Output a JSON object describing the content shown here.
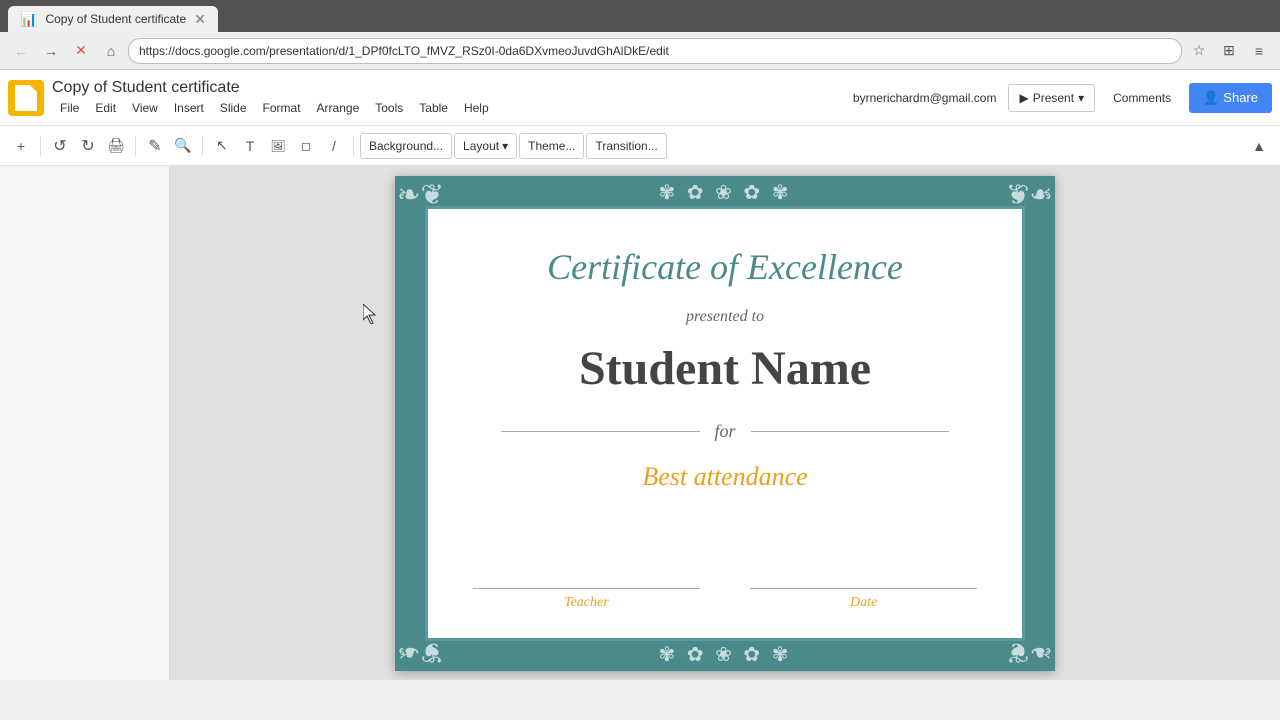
{
  "browser": {
    "url": "https://docs.google.com/presentation/d/1_DPf0fcLTO_fMVZ_RSz0I-0da6DXvmeoJuvdGhAlDkE/edit",
    "tab_title": "Copy of Student certificate",
    "loading": true
  },
  "header": {
    "title": "Copy of Student certificate",
    "user_email": "byrnerichardm@gmail.com",
    "present_label": "Present",
    "comments_label": "Comments",
    "share_label": "Share"
  },
  "menu": {
    "items": [
      "File",
      "Edit",
      "View",
      "Insert",
      "Slide",
      "Format",
      "Arrange",
      "Tools",
      "Table",
      "Help"
    ]
  },
  "toolbar": {
    "background_label": "Background...",
    "layout_label": "Layout",
    "theme_label": "Theme...",
    "transition_label": "Transition..."
  },
  "certificate": {
    "title": "Certificate of Excellence",
    "presented_to": "presented to",
    "student_name": "Student Name",
    "for_text": "for",
    "achievement": "Best attendance",
    "teacher_label": "Teacher",
    "date_label": "Date"
  }
}
